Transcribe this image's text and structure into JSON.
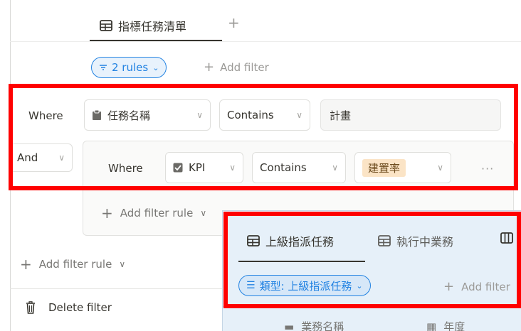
{
  "top_tabs": {
    "active_label": "指標任務清單",
    "add_symbol": "+"
  },
  "filter_bar": {
    "rules_pill": "2 rules",
    "add_filter": "Add filter"
  },
  "rule1": {
    "where": "Where",
    "property": "任務名稱",
    "operator": "Contains",
    "value": "計畫"
  },
  "group": {
    "conjunction": "And",
    "rule": {
      "where": "Where",
      "property": "KPI",
      "operator": "Contains",
      "value_tag": "建置率"
    },
    "more": "···",
    "add_rule": "Add filter rule"
  },
  "add_rule_outer": "Add filter rule",
  "delete_filter": "Delete filter",
  "overlay": {
    "tab1": "上級指派任務",
    "tab2": "執行中業務",
    "pill": "類型: 上級指派任務",
    "add_filter": "Add filter",
    "col1": "業務名稱",
    "col2": "年度"
  },
  "colors": {
    "accent": "#2383e2",
    "highlight": "#ff0000",
    "tag_bg": "#fbe4c6",
    "overlay_bg": "#e6f0f9"
  },
  "icons": [
    "table-icon",
    "plus-icon",
    "filter-lines-icon",
    "chevron-down-icon",
    "clipboard-icon",
    "checkbox-icon",
    "trash-icon",
    "board-icon",
    "list-check-icon",
    "calendar-icon"
  ]
}
